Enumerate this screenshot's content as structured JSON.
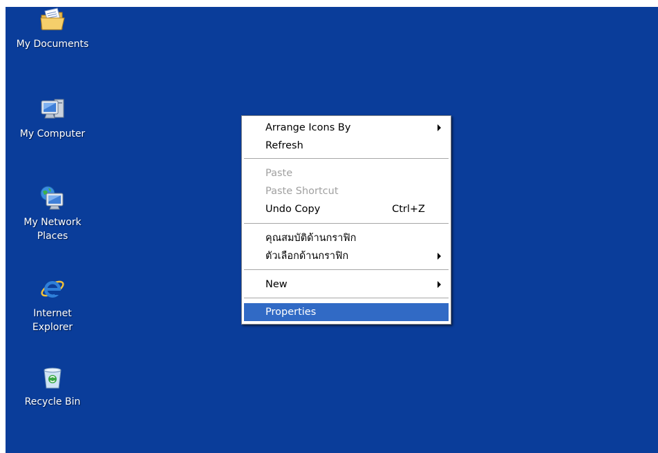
{
  "desktop": {
    "background_color": "#0a3d9a",
    "icons": [
      {
        "label": "My Documents",
        "icon": "folder-documents-icon"
      },
      {
        "label": "My Computer",
        "icon": "computer-icon"
      },
      {
        "label": "My Network\nPlaces",
        "icon": "network-places-icon"
      },
      {
        "label": "Internet\nExplorer",
        "icon": "internet-explorer-icon"
      },
      {
        "label": "Recycle Bin",
        "icon": "recycle-bin-icon"
      }
    ]
  },
  "context_menu": {
    "items": [
      {
        "label": "Arrange Icons By",
        "submenu": true
      },
      {
        "label": "Refresh"
      },
      {
        "label": "Paste",
        "disabled": true
      },
      {
        "label": "Paste Shortcut",
        "disabled": true
      },
      {
        "label": "Undo Copy",
        "shortcut": "Ctrl+Z"
      },
      {
        "label": "คุณสมบัติด้านกราฟิก"
      },
      {
        "label": "ตัวเลือกด้านกราฟิก",
        "submenu": true
      },
      {
        "label": "New",
        "submenu": true
      },
      {
        "label": "Properties",
        "highlighted": true
      }
    ],
    "highlight_color": "#316ac5"
  }
}
